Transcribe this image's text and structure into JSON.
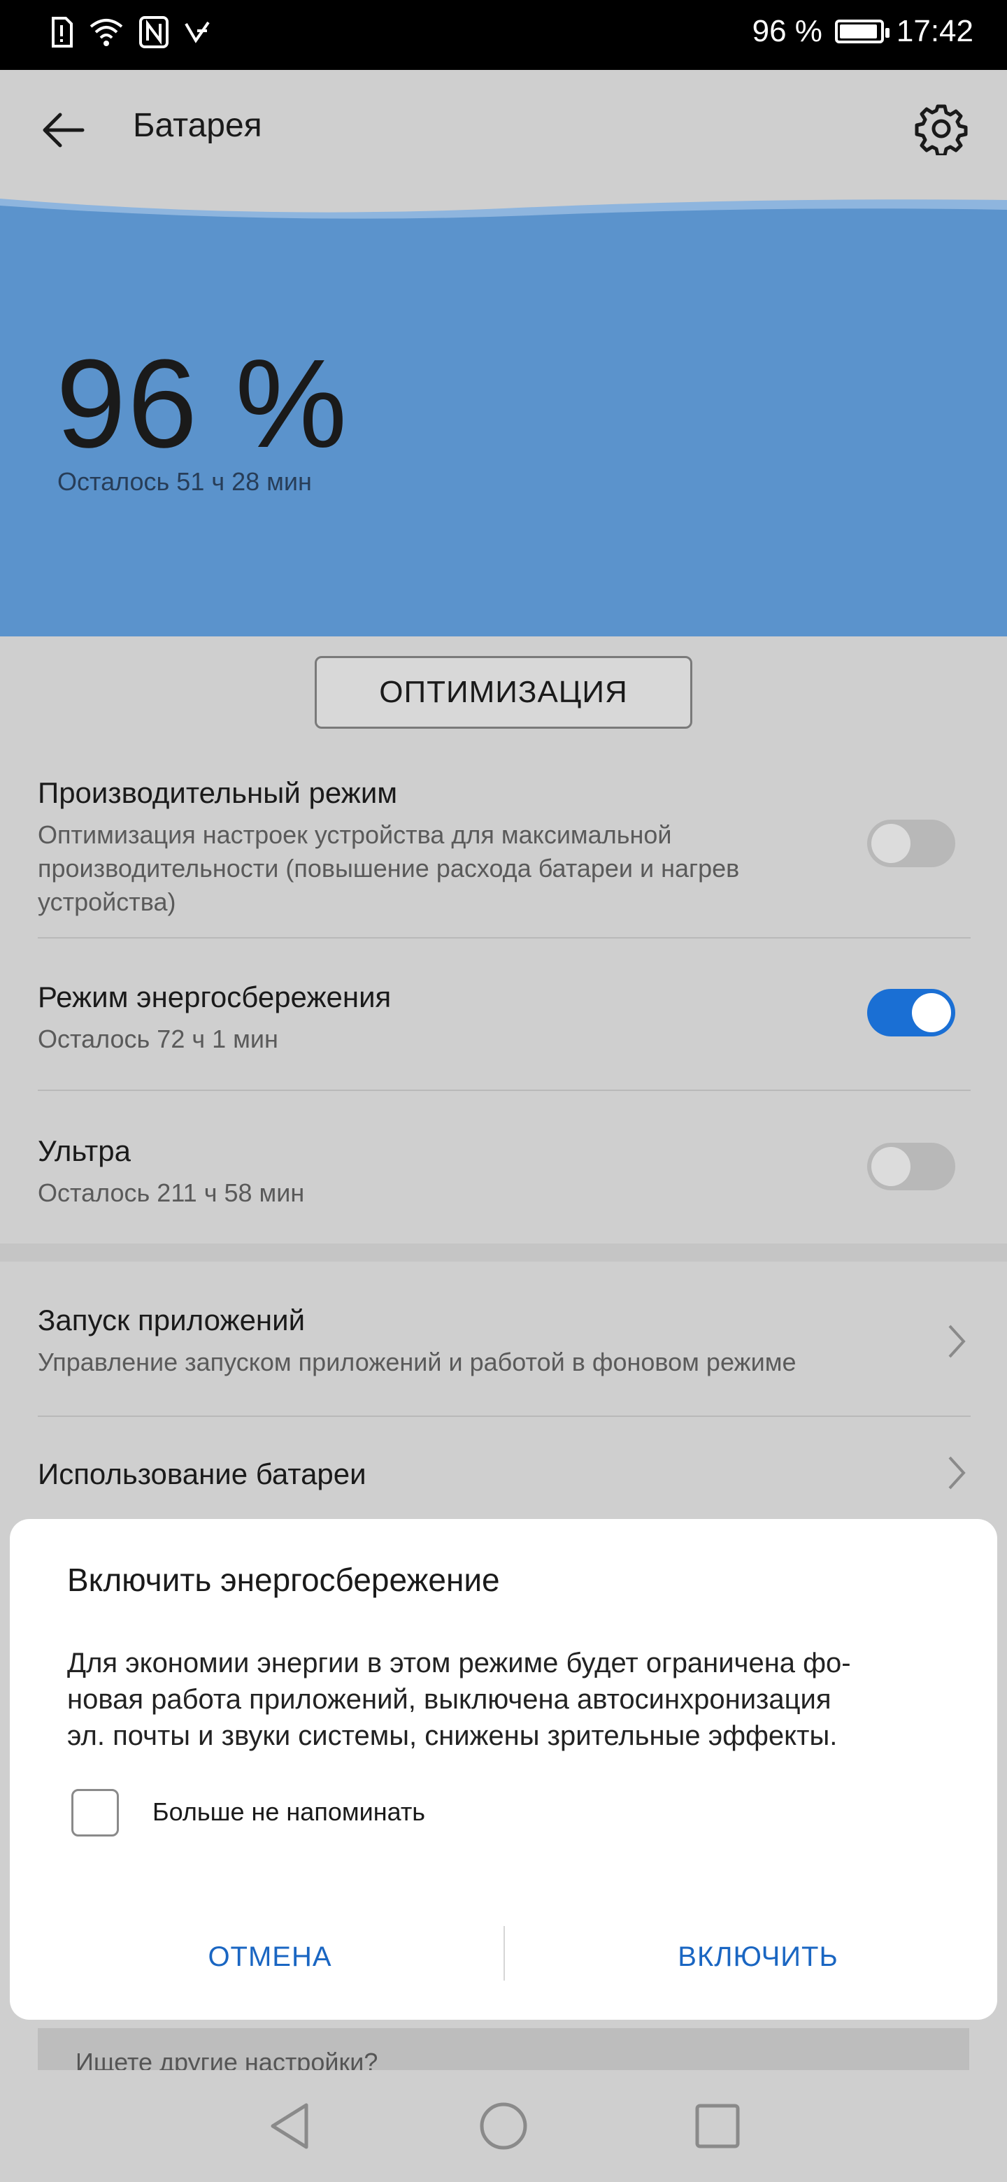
{
  "status_bar": {
    "battery_percent": "96 %",
    "battery_level": 0.96,
    "time": "17:42",
    "icons": [
      "sim-alert-icon",
      "wifi-icon",
      "nfc-icon",
      "data-saver-icon",
      "battery-icon"
    ]
  },
  "app_bar": {
    "title": "Батарея",
    "icons": [
      "back-arrow-icon",
      "gear-icon"
    ]
  },
  "hero": {
    "percent": "96 %",
    "remaining": "Осталось 51 ч 28 мин",
    "color": "#5b93cc"
  },
  "optimize_button": {
    "label": "ОПТИМИЗАЦИЯ"
  },
  "settings": {
    "performance": {
      "title": "Производительный режим",
      "line1": "Оптимизация настроек устройства для максимальной",
      "line2": "производительности (повышение расхода батареи и нагрев",
      "line3": "устройства)",
      "enabled": false
    },
    "power_saving": {
      "title": "Режим энергосбережения",
      "subtitle": "Осталось 72 ч 1 мин",
      "enabled": true
    },
    "ultra": {
      "title": "Ультра",
      "subtitle": "Осталось 211 ч 58 мин",
      "enabled": false
    },
    "app_launch": {
      "title": "Запуск приложений",
      "subtitle": "Управление запуском приложений и работой в фоновом режиме"
    },
    "battery_usage": {
      "title": "Использование батареи"
    }
  },
  "dialog": {
    "title": "Включить энергосбережение",
    "body_line1": "Для экономии энергии в этом режиме будет ограничена фо-",
    "body_line2": "новая работа приложений, выключена автосинхронизация",
    "body_line3": "эл. почты и звуки системы, снижены зрительные эффекты.",
    "checkbox_label": "Больше не напоминать",
    "checkbox_checked": false,
    "cancel": "ОТМЕНА",
    "confirm": "ВКЛЮЧИТЬ"
  },
  "more_settings": {
    "text": "Ищете другие настройки?"
  },
  "colors": {
    "accent": "#1a6fd4",
    "dialog_button": "#1a66c2"
  }
}
